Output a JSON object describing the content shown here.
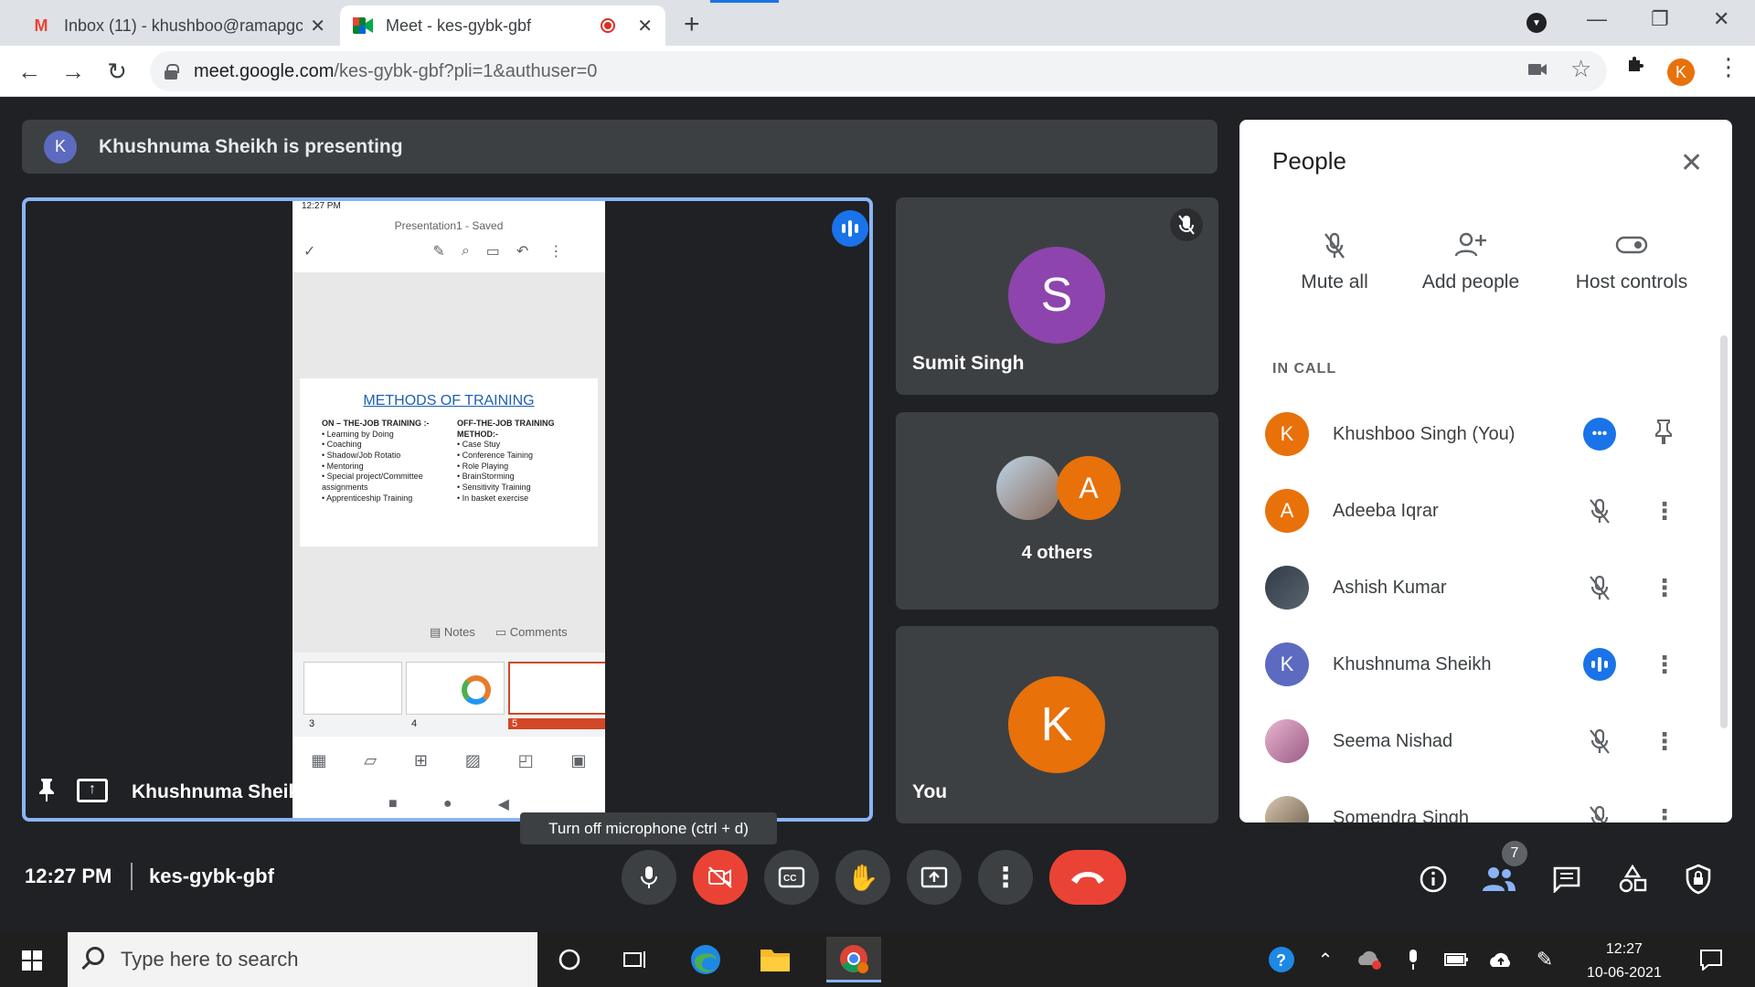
{
  "browser": {
    "tabs": [
      {
        "title": "Inbox (11) - khushboo@ramapgc",
        "favicon": "gmail-icon"
      },
      {
        "title": "Meet - kes-gybk-gbf",
        "favicon": "meet-icon"
      }
    ],
    "url_host": "meet.google.com",
    "url_path": "/kes-gybk-gbf?pli=1&authuser=0",
    "profile_initial": "K"
  },
  "banner": {
    "avatar": "K",
    "text": "Khushnuma Sheikh is presenting"
  },
  "presentation": {
    "presenter_name": "Khushnuma Sheikh",
    "phone_time": "12:27 PM",
    "doc_title": "Presentation1 - Saved",
    "slide_title": "METHODS OF TRAINING",
    "col1_heading": "ON – THE-JOB TRAINING :-",
    "col1_items": [
      "• Learning by Doing",
      "• Coaching",
      "• Shadow/Job Rotatio",
      "• Mentoring",
      "• Special project/Committee assignments",
      "• Apprenticeship Training"
    ],
    "col2_heading": "OFF-THE-JOB TRAINING METHOD:-",
    "col2_items": [
      "• Case Stuy",
      "• Conference Taining",
      "• Role Playing",
      "• BrainStorming",
      "• Sensitivity Training",
      "• In basket exercise"
    ],
    "notes_label": "Notes",
    "comments_label": "Comments",
    "thumb_numbers": [
      "3",
      "4",
      "5"
    ]
  },
  "tiles": {
    "sumit": {
      "initial": "S",
      "name": "Sumit Singh"
    },
    "others": {
      "initial": "A",
      "label": "4 others"
    },
    "you": {
      "initial": "K",
      "name": "You"
    }
  },
  "tooltip": "Turn off microphone (ctrl + d)",
  "people_panel": {
    "title": "People",
    "actions": [
      {
        "label": "Mute all",
        "icon": "mic-off-icon"
      },
      {
        "label": "Add people",
        "icon": "add-person-icon"
      },
      {
        "label": "Host controls",
        "icon": "toggle-icon"
      }
    ],
    "section": "IN CALL",
    "participants": [
      {
        "name": "Khushboo Singh (You)",
        "initial": "K",
        "color": "#e8710a"
      },
      {
        "name": "Adeeba Iqrar",
        "initial": "A",
        "color": "#e8710a"
      },
      {
        "name": "Ashish Kumar",
        "initial": "",
        "color": "#4a4a4a"
      },
      {
        "name": "Khushnuma Sheikh",
        "initial": "K",
        "color": "#5c6bc0"
      },
      {
        "name": "Seema Nishad",
        "initial": "",
        "color": "#c48aa8"
      },
      {
        "name": "Somendra Singh",
        "initial": "",
        "color": "#8a7a6a"
      }
    ]
  },
  "bottom_bar": {
    "time": "12:27 PM",
    "meeting_code": "kes-gybk-gbf",
    "participant_count": "7"
  },
  "taskbar": {
    "search_placeholder": "Type here to search",
    "time": "12:27",
    "date": "10-06-2021"
  },
  "colors": {
    "accent": "#1a73e8",
    "danger": "#ea4335",
    "avatar_orange": "#e8710a",
    "avatar_purple": "#8e44ad"
  }
}
